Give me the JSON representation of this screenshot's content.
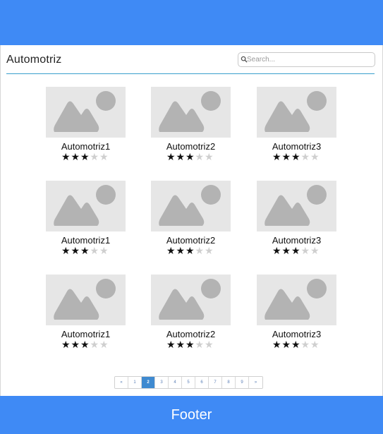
{
  "header": {
    "background": "#3f8af5"
  },
  "page": {
    "title": "Automotriz"
  },
  "search": {
    "placeholder": "Search...",
    "value": ""
  },
  "products": [
    {
      "name": "Automotriz1",
      "rating": 3,
      "max_rating": 5
    },
    {
      "name": "Automotriz2",
      "rating": 3,
      "max_rating": 5
    },
    {
      "name": "Automotriz3",
      "rating": 3,
      "max_rating": 5
    },
    {
      "name": "Automotriz1",
      "rating": 3,
      "max_rating": 5
    },
    {
      "name": "Automotriz2",
      "rating": 3,
      "max_rating": 5
    },
    {
      "name": "Automotriz3",
      "rating": 3,
      "max_rating": 5
    },
    {
      "name": "Automotriz1",
      "rating": 3,
      "max_rating": 5
    },
    {
      "name": "Automotriz2",
      "rating": 3,
      "max_rating": 5
    },
    {
      "name": "Automotriz3",
      "rating": 3,
      "max_rating": 5
    }
  ],
  "pagination": {
    "prev": "«",
    "next": "»",
    "pages": [
      "1",
      "2",
      "3",
      "4",
      "5",
      "6",
      "7",
      "8",
      "9"
    ],
    "current": "2"
  },
  "footer": {
    "label": "Footer"
  },
  "colors": {
    "accent": "#3f8af5",
    "divider": "#3aa0cc",
    "active_page": "#3f8ad0"
  }
}
